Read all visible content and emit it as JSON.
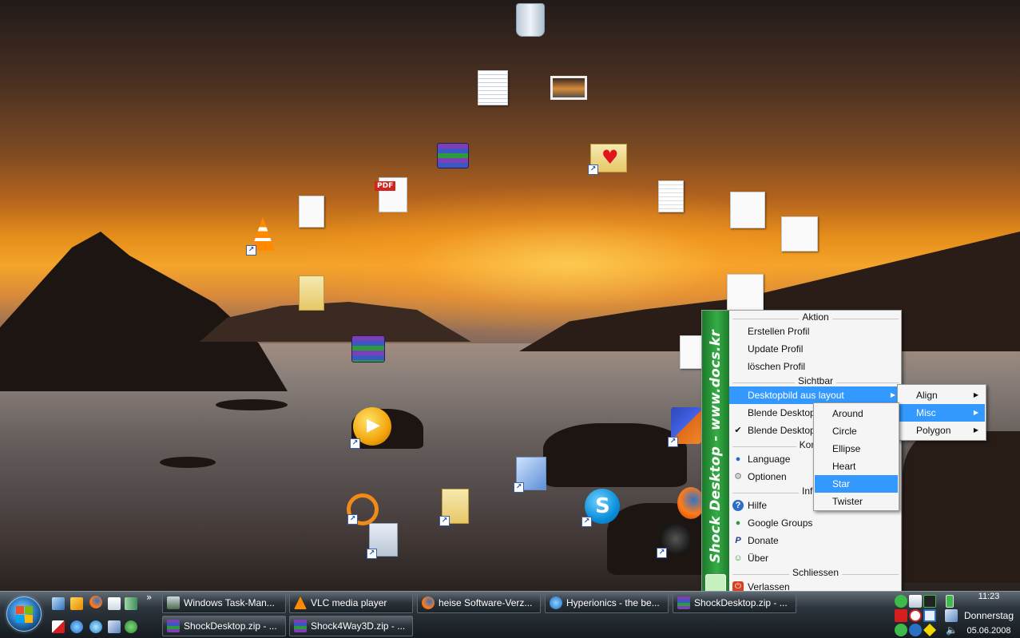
{
  "menu": {
    "side_text": "Shock Desktop - www.docs.kr",
    "sections": {
      "aktion": "Aktion",
      "sichtbar": "Sichtbar",
      "konfig": "Konfigu",
      "inform": "Inform",
      "schliessen": "Schliessen"
    },
    "items": {
      "erstellen": "Erstellen Profil",
      "update": "Update Profil",
      "loeschen": "löschen Profil",
      "desktopbild": "Desktopbild aus layout",
      "blende1": "Blende Desktop",
      "blende2": "Blende Desktop",
      "language": "Language",
      "optionen": "Optionen",
      "hilfe": "Hilfe",
      "google": "Google Groups",
      "donate": "Donate",
      "ueber": "Über",
      "verlassen": "Verlassen"
    }
  },
  "submenu_layout": {
    "items": [
      "Align",
      "Misc",
      "Polygon"
    ],
    "selected": "Misc"
  },
  "submenu_misc": {
    "items": [
      "Around",
      "Circle",
      "Ellipse",
      "Heart",
      "Star",
      "Twister"
    ],
    "selected": "Star"
  },
  "taskbar": {
    "tasks": [
      "Windows Task-Man...",
      "VLC media player",
      "heise Software-Verz...",
      "Hyperionics - the be...",
      "ShockDesktop.zip - ...",
      "ShockDesktop.zip - ...",
      "Shock4Way3D.zip - ..."
    ],
    "overflow": "»"
  },
  "clock": {
    "time": "11:23",
    "day": "Donnerstag",
    "date": "05.06.2008"
  },
  "colors": {
    "menu_highlight": "#3399ff",
    "sidebar_green": "#35ac45"
  }
}
